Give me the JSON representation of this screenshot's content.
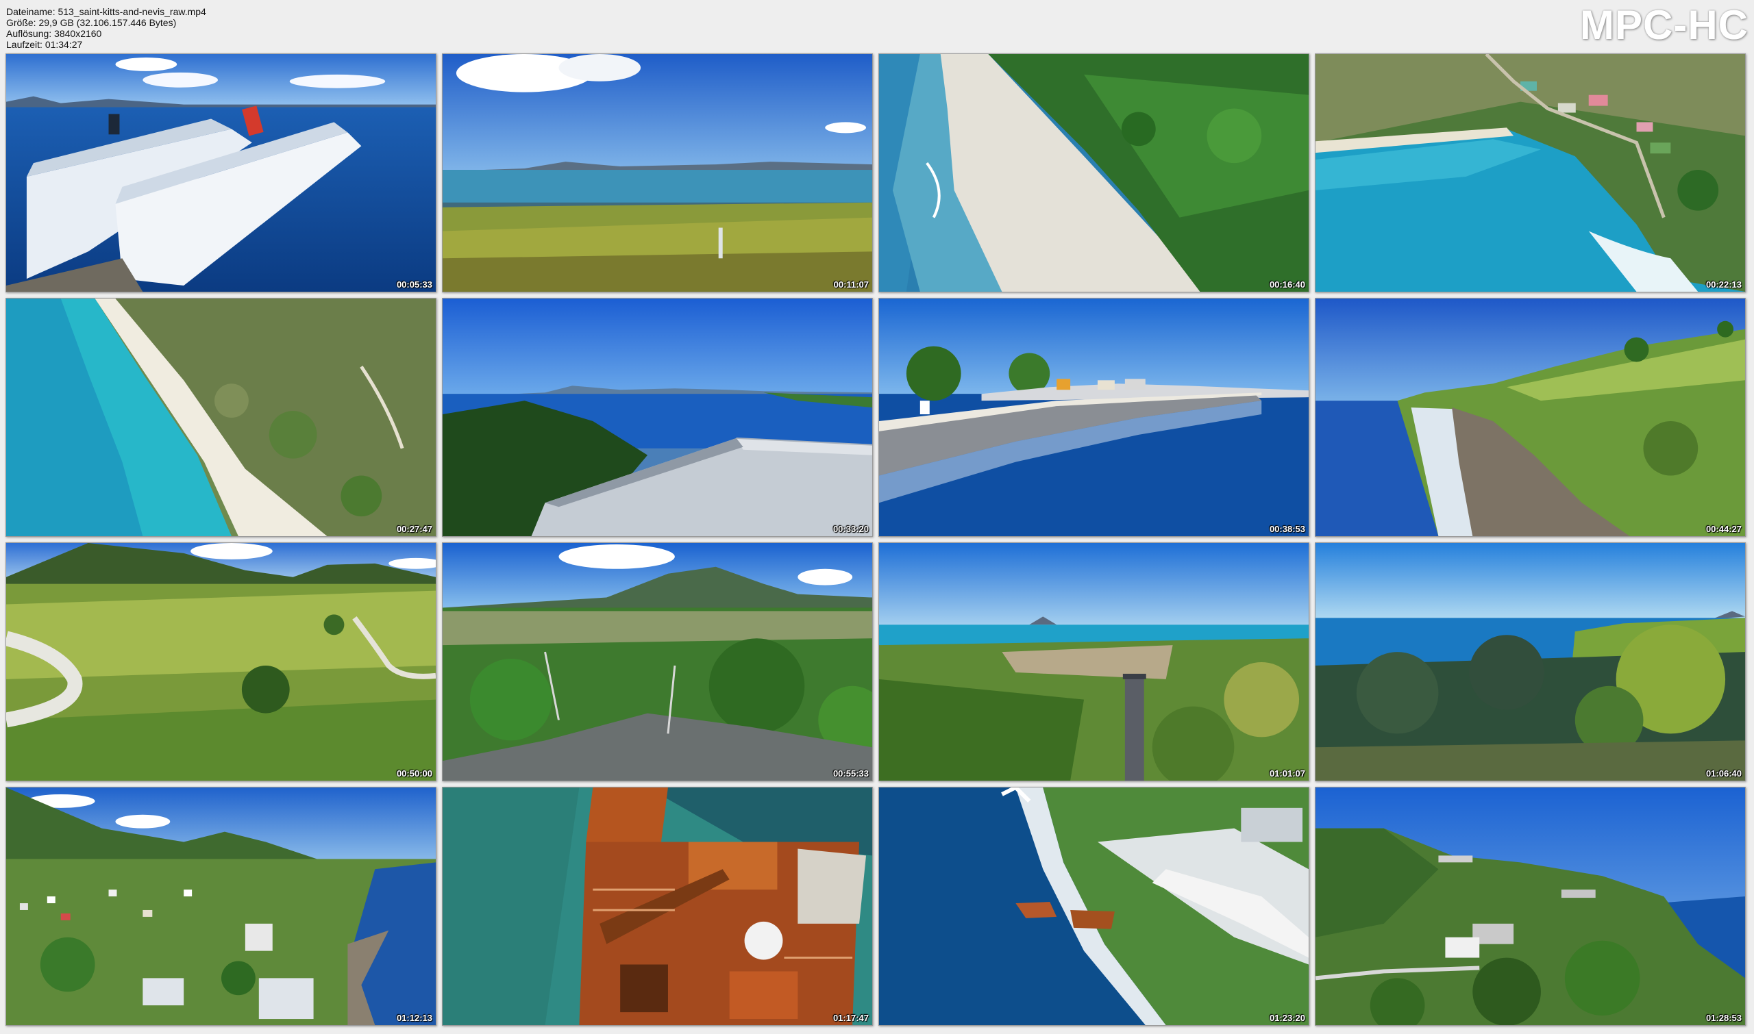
{
  "info": {
    "filename": "Dateiname: 513_saint-kitts-and-nevis_raw.mp4",
    "size": "Größe: 29,9 GB (32.106.157.446 Bytes)",
    "resolution": "Auflösung: 3840x2160",
    "duration": "Laufzeit: 01:34:27"
  },
  "brand": "MPC-HC",
  "thumbnails": [
    {
      "timestamp": "00:05:33",
      "scene": "cruise-ships-icon"
    },
    {
      "timestamp": "00:11:07",
      "scene": "grassy-shore-icon"
    },
    {
      "timestamp": "00:16:40",
      "scene": "beach-aerial-icon"
    },
    {
      "timestamp": "00:22:13",
      "scene": "bay-village-icon"
    },
    {
      "timestamp": "00:27:47",
      "scene": "turquoise-beach-icon"
    },
    {
      "timestamp": "00:33:20",
      "scene": "rooftop-sea-view-icon"
    },
    {
      "timestamp": "00:38:53",
      "scene": "breakwater-promenade-icon"
    },
    {
      "timestamp": "00:44:27",
      "scene": "coastal-hills-icon"
    },
    {
      "timestamp": "00:50:00",
      "scene": "green-hillside-road-icon"
    },
    {
      "timestamp": "00:55:33",
      "scene": "volcano-forest-icon"
    },
    {
      "timestamp": "01:01:07",
      "scene": "chimney-field-icon"
    },
    {
      "timestamp": "01:06:40",
      "scene": "shrub-coast-icon"
    },
    {
      "timestamp": "01:12:13",
      "scene": "town-bay-icon"
    },
    {
      "timestamp": "01:17:47",
      "scene": "rusty-wreck-icon"
    },
    {
      "timestamp": "01:23:20",
      "scene": "pier-wreck-icon"
    },
    {
      "timestamp": "01:28:53",
      "scene": "hill-fortress-icon"
    }
  ]
}
